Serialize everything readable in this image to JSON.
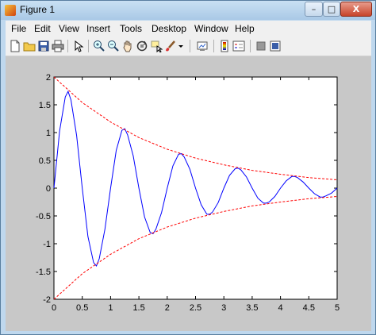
{
  "window": {
    "title": "Figure 1",
    "min_label": "–",
    "max_label": "□",
    "close_label": "X"
  },
  "menu": [
    {
      "label": "File"
    },
    {
      "label": "Edit"
    },
    {
      "label": "View"
    },
    {
      "label": "Insert"
    },
    {
      "label": "Tools"
    },
    {
      "label": "Desktop"
    },
    {
      "label": "Window"
    },
    {
      "label": "Help"
    }
  ],
  "toolbar": {
    "icons": [
      "new-figure-icon",
      "open-file-icon",
      "save-icon",
      "print-icon",
      "select-arrow-icon",
      "zoom-in-icon",
      "zoom-out-icon",
      "pan-hand-icon",
      "rotate-3d-icon",
      "data-cursor-icon",
      "brush-icon",
      "brush-dropdown-icon",
      "link-plot-icon",
      "colorbar-icon",
      "legend-icon",
      "hide-plot-tools-icon",
      "show-plot-tools-icon"
    ]
  },
  "colors": {
    "signal": "#0000ff",
    "envelope": "#ff0000",
    "figure_bg": "#c8c8c8",
    "axes_bg": "#ffffff"
  },
  "chart_data": {
    "type": "line",
    "title": "",
    "xlabel": "",
    "ylabel": "",
    "xlim": [
      0,
      5
    ],
    "ylim": [
      -2,
      2
    ],
    "grid": false,
    "xticks": [
      "0",
      "0.5",
      "1",
      "1.5",
      "2",
      "2.5",
      "3",
      "3.5",
      "4",
      "4.5",
      "5"
    ],
    "yticks": [
      "-2",
      "-1.5",
      "-1",
      "-0.5",
      "0",
      "0.5",
      "1",
      "1.5",
      "2"
    ],
    "series": [
      {
        "style": "solid",
        "color": "#0000ff",
        "x": [
          0,
          0.1,
          0.2,
          0.25,
          0.3,
          0.4,
          0.5,
          0.6,
          0.7,
          0.75,
          0.8,
          0.9,
          1.0,
          1.1,
          1.2,
          1.25,
          1.3,
          1.4,
          1.5,
          1.6,
          1.7,
          1.75,
          1.8,
          1.9,
          2.0,
          2.1,
          2.2,
          2.25,
          2.3,
          2.4,
          2.5,
          2.6,
          2.7,
          2.75,
          2.8,
          2.9,
          3.0,
          3.1,
          3.2,
          3.25,
          3.3,
          3.4,
          3.5,
          3.6,
          3.7,
          3.75,
          3.8,
          3.9,
          4.0,
          4.1,
          4.2,
          4.25,
          4.3,
          4.4,
          4.5,
          4.6,
          4.7,
          4.75,
          4.8,
          4.9,
          5.0
        ],
        "y": [
          0,
          1.03,
          1.64,
          1.74,
          1.59,
          0.95,
          0,
          -0.87,
          -1.34,
          -1.4,
          -1.27,
          -0.74,
          0,
          0.68,
          1.04,
          1.07,
          0.96,
          0.58,
          0,
          -0.52,
          -0.8,
          -0.82,
          -0.74,
          -0.44,
          0,
          0.4,
          0.61,
          0.62,
          0.56,
          0.34,
          0,
          -0.3,
          -0.47,
          -0.47,
          -0.43,
          -0.26,
          0,
          0.23,
          0.35,
          0.36,
          0.33,
          0.2,
          0,
          -0.18,
          -0.27,
          -0.27,
          -0.25,
          -0.15,
          0,
          0.13,
          0.21,
          0.21,
          0.19,
          0.11,
          0,
          -0.1,
          -0.16,
          -0.16,
          -0.14,
          -0.09,
          0
        ]
      },
      {
        "style": "dashed",
        "color": "#ff0000",
        "x": [
          0,
          0.5,
          1,
          1.5,
          2,
          2.5,
          3,
          3.5,
          4,
          4.5,
          5
        ],
        "y": [
          2,
          1.54,
          1.19,
          0.91,
          0.7,
          0.54,
          0.42,
          0.32,
          0.25,
          0.19,
          0.15
        ]
      },
      {
        "style": "dashed",
        "color": "#ff0000",
        "x": [
          0,
          0.5,
          1,
          1.5,
          2,
          2.5,
          3,
          3.5,
          4,
          4.5,
          5
        ],
        "y": [
          -2,
          -1.54,
          -1.19,
          -0.91,
          -0.7,
          -0.54,
          -0.42,
          -0.32,
          -0.25,
          -0.19,
          -0.15
        ]
      }
    ]
  }
}
